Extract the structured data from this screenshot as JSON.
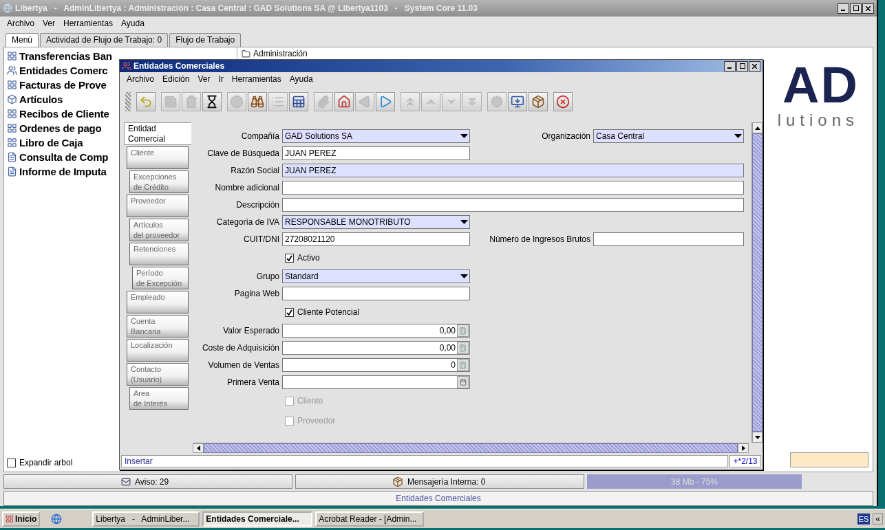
{
  "window": {
    "title": "Libertya   -   AdminLibertya : Administración : Casa Central : GAD Solutions SA @ Libertya1103   -   System Core 11.03"
  },
  "menu": [
    "Archivo",
    "Ver",
    "Herramientas",
    "Ayuda"
  ],
  "tabs": [
    {
      "label": "Menú",
      "selected": true
    },
    {
      "label": "Actividad de Flujo de Trabajo: 0",
      "selected": false
    },
    {
      "label": "Flujo de Trabajo",
      "selected": false
    }
  ],
  "sidebar": {
    "items": [
      "Transferencias Ban",
      "Entidades Comerc",
      "Facturas de Prove",
      "Artículos",
      "Recibos de Cliente",
      "Ordenes de pago",
      "Libro de Caja",
      "Consulta de Comp",
      "Informe de Imputa"
    ],
    "expand_tree": {
      "label": "Expandir arbol",
      "checked": false
    }
  },
  "tree": {
    "items": [
      "Administración"
    ]
  },
  "logo": {
    "big": "AD",
    "small": "lutions"
  },
  "dialog": {
    "title": "Entidades Comerciales",
    "menu": [
      "Archivo",
      "Edición",
      "Ver",
      "Ir",
      "Herramientas",
      "Ayuda"
    ],
    "toolbar": [
      [
        {
          "disabled": false
        }
      ],
      [
        {
          "disabled": true
        },
        {
          "disabled": true
        },
        {
          "disabled": false
        }
      ],
      [
        {
          "disabled": true
        },
        {
          "disabled": false
        },
        {
          "disabled": true
        },
        {
          "disabled": false
        }
      ],
      [
        {
          "disabled": true
        },
        {
          "disabled": false
        },
        {
          "disabled": true
        },
        {
          "disabled": false
        }
      ],
      [
        {
          "disabled": true
        },
        {
          "disabled": true
        },
        {
          "disabled": true
        },
        {
          "disabled": true
        }
      ],
      [
        {
          "disabled": true
        },
        {
          "disabled": false
        },
        {
          "disabled": false
        }
      ],
      [
        {
          "disabled": false
        }
      ]
    ],
    "tabs": [
      {
        "label": "Entidad\nComercial",
        "selected": true
      },
      {
        "label": "Cliente",
        "selected": false,
        "children": [
          {
            "label": "Excepciones\nde Crédito",
            "selected": false
          }
        ]
      },
      {
        "label": "Proveedor",
        "selected": false,
        "children": [
          {
            "label": "Artículos\ndel proveedor",
            "selected": false
          },
          {
            "label": "Retenciones",
            "selected": false,
            "children": [
              {
                "label": "Período\nde Excepción",
                "selected": false
              }
            ]
          }
        ]
      },
      {
        "label": "Empleado",
        "selected": false
      },
      {
        "label": "Cuenta\nBancaria",
        "selected": false
      },
      {
        "label": "Localización",
        "selected": false
      },
      {
        "label": "Contacto\n(Usuario)",
        "selected": false,
        "children": [
          {
            "label": "Area\nde Interés",
            "selected": false
          }
        ]
      }
    ],
    "rows": [
      [
        {
          "kind": "combo",
          "label": "Compañía",
          "value": "GAD Solutions SA",
          "mandatory": true
        },
        {
          "kind": "combo",
          "label": "Organización",
          "value": "Casa Central",
          "mandatory": true
        }
      ],
      [
        {
          "kind": "text",
          "label": "Clave de Búsqueda",
          "value": "JUAN PEREZ",
          "mandatory": false,
          "wide": false
        }
      ],
      [
        {
          "kind": "text",
          "label": "Razón Social",
          "value": "JUAN PEREZ",
          "mandatory": true,
          "wide": true
        }
      ],
      [
        {
          "kind": "text",
          "label": "Nombre adicional",
          "mandatory": false,
          "wide": true
        }
      ],
      [
        {
          "kind": "text",
          "label": "Descripción",
          "mandatory": false,
          "wide": true
        }
      ],
      [
        {
          "kind": "combo",
          "label": "Categoría de IVA",
          "value": "RESPONSABLE MONOTRIBUTO",
          "mandatory": true
        }
      ],
      [
        {
          "kind": "text",
          "label": "CUIT/DNI",
          "value": "27208021120",
          "mandatory": false,
          "wide": false
        },
        {
          "kind": "text",
          "label": "Número de Ingresos Brutos",
          "mandatory": false
        }
      ],
      [
        {
          "kind": "check",
          "label": "Activo",
          "checked": true,
          "disabled": false
        }
      ],
      [
        {
          "kind": "combo",
          "label": "Grupo",
          "value": "Standard",
          "mandatory": true
        }
      ],
      [
        {
          "kind": "text",
          "label": "Pagina Web",
          "mandatory": false,
          "wide": false
        }
      ],
      [
        {
          "kind": "check",
          "label": "Cliente Potencial",
          "checked": true,
          "disabled": false
        }
      ],
      [
        {
          "kind": "number",
          "label": "Valor Esperado",
          "value": "0,00"
        }
      ],
      [
        {
          "kind": "number",
          "label": "Coste de Adquisición",
          "value": "0,00"
        }
      ],
      [
        {
          "kind": "number",
          "label": "Volumen de Ventas",
          "value": "0"
        }
      ],
      [
        {
          "kind": "date",
          "label": "Primera Venta"
        }
      ],
      [
        {
          "kind": "check",
          "label": "Cliente",
          "checked": false,
          "disabled": true
        }
      ],
      [
        {
          "kind": "check",
          "label": "Proveedor",
          "checked": false,
          "disabled": true
        }
      ]
    ],
    "status": {
      "text": "Insertar",
      "record": "+*2/13"
    }
  },
  "status_bar": {
    "notices": "Aviso: 29",
    "messages": "Mensajería Interna: 0",
    "memory": "38 Mb - 75%",
    "window": "Entidades Comerciales"
  },
  "taskbar": {
    "start": "Inicio",
    "tasks": [
      {
        "label": "Libertya   -   AdminLiber...",
        "selected": false
      },
      {
        "label": "Entidades Comerciale...",
        "selected": true
      },
      {
        "label": "Acrobat Reader - [Admin...",
        "selected": false
      }
    ],
    "language": "ES",
    "expand": "«"
  }
}
